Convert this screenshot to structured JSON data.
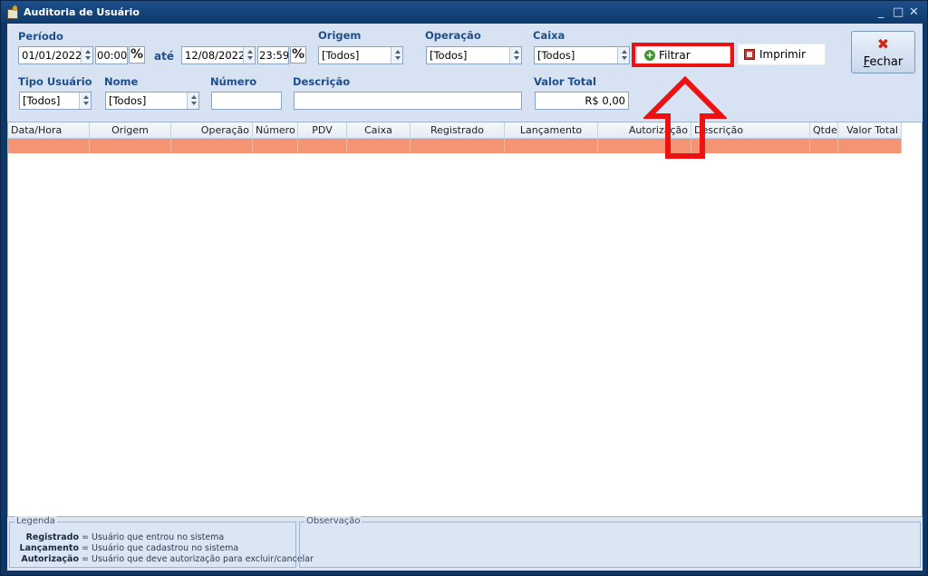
{
  "window": {
    "title": "Auditoria de Usuário",
    "minimize": "_",
    "maximize": "□",
    "close": "✕"
  },
  "filters": {
    "periodo_label": "Período",
    "start_date": "01/01/2022",
    "start_time": "00:00",
    "ate_label": "até",
    "end_date": "12/08/2022",
    "end_time": "23:59",
    "origem_label": "Origem",
    "origem_value": "[Todos]",
    "operacao_label": "Operação",
    "operacao_value": "[Todos]",
    "caixa_label": "Caixa",
    "caixa_value": "[Todos]",
    "tipo_usuario_label": "Tipo Usuário",
    "tipo_usuario_value": "[Todos]",
    "nome_label": "Nome",
    "nome_value": "[Todos]",
    "numero_label": "Número",
    "numero_value": "",
    "descricao_label": "Descrição",
    "descricao_value": "",
    "valor_total_label": "Valor Total",
    "valor_total_value": "R$ 0,00"
  },
  "buttons": {
    "filtrar": "Filtrar",
    "imprimir": "Imprimir",
    "fechar_u": "F",
    "fechar_rest": "echar",
    "toggle_symbol": "%"
  },
  "grid": {
    "columns": [
      "Data/Hora",
      "Origem",
      "Operação",
      "Número",
      "PDV",
      "Caixa",
      "Registrado",
      "Lançamento",
      "Autorização",
      "Descrição",
      "Qtde",
      "Valor Total"
    ]
  },
  "legend": {
    "caption": "Legenda",
    "items": [
      {
        "term": "Registrado",
        "desc": "Usuário que entrou no sistema"
      },
      {
        "term": "Lançamento",
        "desc": "Usuário que cadastrou no sistema"
      },
      {
        "term": "Autorização",
        "desc": "Usuário que deve autorização para excluir/cancelar"
      }
    ],
    "separator": "="
  },
  "observacao": {
    "caption": "Observação"
  },
  "colors": {
    "highlight": "#ee1111",
    "row_selected": "#f59472",
    "label_blue": "#1f4e8c"
  }
}
